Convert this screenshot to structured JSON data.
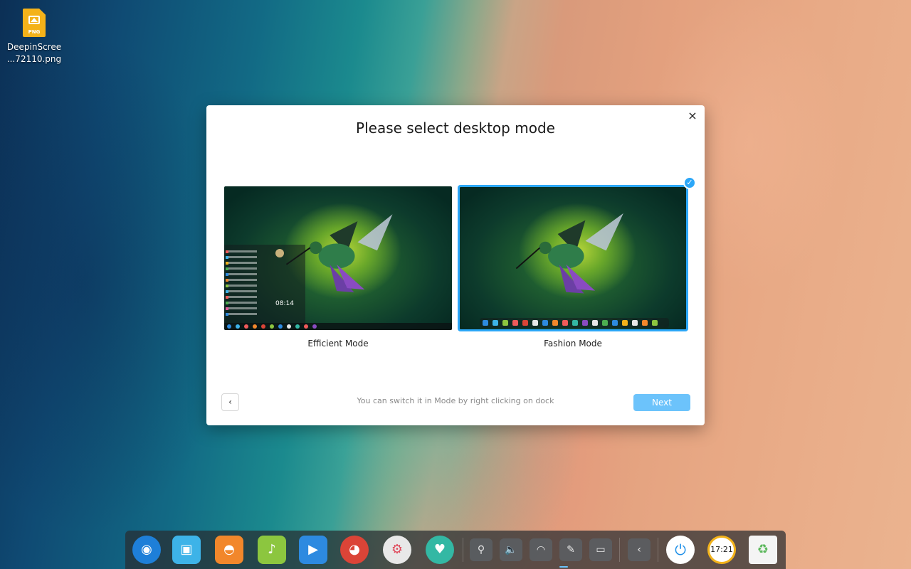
{
  "desktop": {
    "file_icon": {
      "type_tag": "PNG",
      "label_line1": "DeepinScree",
      "label_line2": "...72110.png",
      "icon": "png-file-icon"
    }
  },
  "dialog": {
    "title": "Please select desktop mode",
    "close_label": "×",
    "modes": [
      {
        "label": "Efficient Mode",
        "selected": false,
        "preview_time": "08:14"
      },
      {
        "label": "Fashion Mode",
        "selected": true
      }
    ],
    "selected_check": "✓",
    "back_label": "‹",
    "hint": "You can switch it in Mode by right clicking on dock",
    "next_label": "Next",
    "accent": "#2ca7f8",
    "next_color": "#6cc3fb"
  },
  "dock": {
    "apps": [
      {
        "name": "launcher-icon",
        "glyph": "◉",
        "color": "#1e7fd8"
      },
      {
        "name": "file-manager-icon",
        "glyph": "▣",
        "color": "#3db3e8"
      },
      {
        "name": "app-store-icon",
        "glyph": "◓",
        "color": "#f2872b"
      },
      {
        "name": "music-icon",
        "glyph": "♪",
        "color": "#8cc63f"
      },
      {
        "name": "video-icon",
        "glyph": "▶",
        "color": "#2d8ae0"
      },
      {
        "name": "chrome-icon",
        "glyph": "◕",
        "color": "#db4437"
      },
      {
        "name": "settings-icon",
        "glyph": "⚙",
        "color": "#e8e8e8"
      },
      {
        "name": "handshake-icon",
        "glyph": "♥",
        "color": "#33b8a4"
      }
    ],
    "tray": [
      {
        "name": "usb-icon",
        "glyph": "⚲"
      },
      {
        "name": "volume-icon",
        "glyph": "🔈"
      },
      {
        "name": "wifi-icon",
        "glyph": "◠"
      },
      {
        "name": "pen-icon",
        "glyph": "✎"
      },
      {
        "name": "battery-icon",
        "glyph": "▭"
      },
      {
        "name": "collapse-icon",
        "glyph": "‹"
      }
    ],
    "power_glyph": "⏻",
    "clock_text": "17:21",
    "trash_glyph": "♻"
  }
}
